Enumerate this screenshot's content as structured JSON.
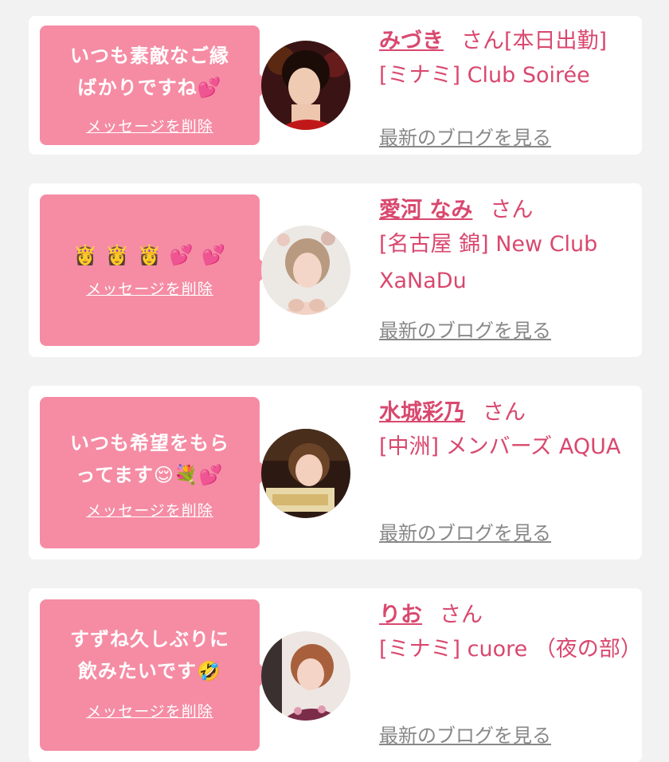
{
  "colors": {
    "bubble": "#f58ca4",
    "accent": "#d9486e",
    "muted": "#888888",
    "background": "#f2f2f2"
  },
  "cards": [
    {
      "message": "いつも素敵なご縁\nばかりですね💕",
      "delete_label": "メッセージを削除",
      "avatar_icon": "profile-photo",
      "name": "みづき",
      "honorific": "さん",
      "status": "[本日出勤]",
      "shop": "[ミナミ] Club Soirée",
      "blog_link": "最新のブログを見る"
    },
    {
      "message": "👸 👸 👸 💕 💕",
      "delete_label": "メッセージを削除",
      "avatar_icon": "profile-photo",
      "name": "愛河 なみ",
      "honorific": "さん",
      "status": "",
      "shop": "[名古屋 錦] New Club XaNaDu",
      "blog_link": "最新のブログを見る"
    },
    {
      "message": "いつも希望をもら\nってます😌💐💕",
      "delete_label": "メッセージを削除",
      "avatar_icon": "profile-photo",
      "name": "水城彩乃",
      "honorific": "さん",
      "status": "",
      "shop": "[中洲] メンバーズ AQUA",
      "blog_link": "最新のブログを見る"
    },
    {
      "message": "すずね久しぶりに\n飲みたいです🤣",
      "delete_label": "メッセージを削除",
      "avatar_icon": "profile-photo",
      "name": "りお",
      "honorific": "さん",
      "status": "",
      "shop": "[ミナミ] cuore （夜の部）",
      "blog_link": "最新のブログを見る"
    }
  ]
}
